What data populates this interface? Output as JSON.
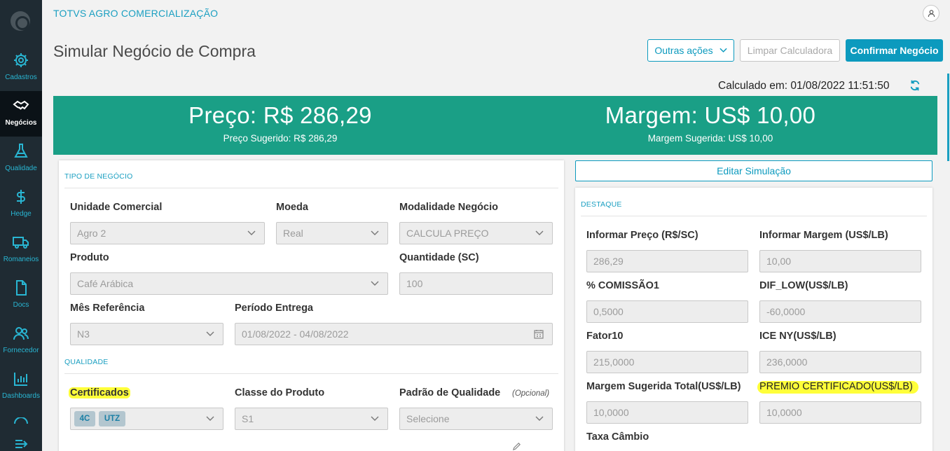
{
  "app": {
    "brand": "TOTVS AGRO COMERCIALIZAÇÃO"
  },
  "sidebar": {
    "items": [
      {
        "label": "Cadastros",
        "icon": "gear-icon"
      },
      {
        "label": "Negócios",
        "icon": "handshake-icon",
        "active": true
      },
      {
        "label": "Qualidade",
        "icon": "flask-icon"
      },
      {
        "label": "Hedge",
        "icon": "dollar-icon"
      },
      {
        "label": "Romaneios",
        "icon": "truck-icon"
      },
      {
        "label": "Docs",
        "icon": "document-icon"
      },
      {
        "label": "Fornecedor",
        "icon": "users-icon"
      },
      {
        "label": "Dashboards",
        "icon": "bar-chart-icon"
      }
    ]
  },
  "page": {
    "title": "Simular Negócio de Compra"
  },
  "toolbar": {
    "other_actions": "Outras ações",
    "clear": "Limpar Calculadora",
    "confirm": "Confirmar Negócio"
  },
  "calc": {
    "text": "Calculado em: 01/08/2022 11:51:50"
  },
  "banner": {
    "price": "Preço: R$ 286,29",
    "price_suggested": "Preço Sugerido: R$ 286,29",
    "margin": "Margem: US$ 10,00",
    "margin_suggested": "Margem Sugerida: US$ 10,00"
  },
  "left": {
    "tipo_title": "TIPO DE NEGÓCIO",
    "unidade": {
      "label": "Unidade Comercial",
      "value": "Agro 2"
    },
    "moeda": {
      "label": "Moeda",
      "value": "Real"
    },
    "modalidade": {
      "label": "Modalidade Negócio",
      "value": "CALCULA PREÇO"
    },
    "produto": {
      "label": "Produto",
      "value": "Café Arábica"
    },
    "quantidade": {
      "label": "Quantidade (SC)",
      "value": "100"
    },
    "mes": {
      "label": "Mês Referência",
      "value": "N3"
    },
    "periodo": {
      "label": "Período Entrega",
      "value": "01/08/2022 - 04/08/2022"
    },
    "qualidade_title": "QUALIDADE",
    "certificados": {
      "label": "Certificados",
      "chips": [
        "4C",
        "UTZ"
      ]
    },
    "classe": {
      "label": "Classe do Produto",
      "value": "S1"
    },
    "padrao": {
      "label": "Padrão de Qualidade",
      "optional": "(Opcional)",
      "placeholder": "Selecione"
    }
  },
  "right": {
    "edit_sim": "Editar Simulação",
    "destaque_title": "DESTAQUE",
    "informar_preco": {
      "label": "Informar Preço (R$/SC)",
      "value": "286,29"
    },
    "informar_margem": {
      "label": "Informar Margem (US$/LB)",
      "value": "10,00"
    },
    "comissao": {
      "label": "% COMISSÃO1",
      "value": "0,5000"
    },
    "dif_low": {
      "label": "DIF_LOW(US$/LB)",
      "value": "-60,0000"
    },
    "fator": {
      "label": "Fator10",
      "value": "215,0000"
    },
    "ice": {
      "label": "ICE NY(US$/LB)",
      "value": "236,0000"
    },
    "margem_total": {
      "label": "Margem Sugerida Total(US$/LB)",
      "value": "10,0000"
    },
    "premio": {
      "label": "PREMIO CERTIFICADO(US$/LB)",
      "value": "10,0000"
    },
    "taxa": {
      "label": "Taxa Câmbio"
    }
  },
  "colors": {
    "accent": "#0c9abe",
    "banner": "#1a9f86",
    "sidebar": "#1f2b33",
    "highlight": "#ffff3a"
  }
}
